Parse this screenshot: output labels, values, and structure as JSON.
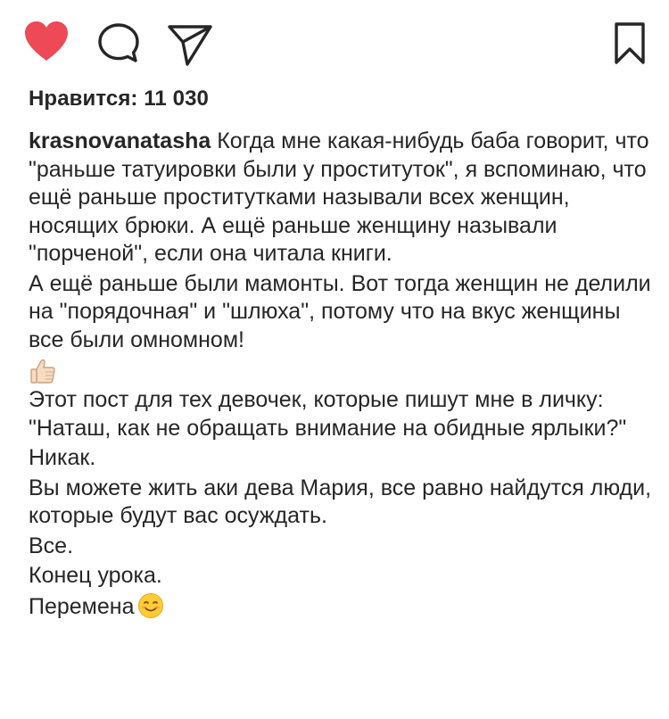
{
  "actions": {
    "like_icon": "heart-filled-icon",
    "comment_icon": "comment-bubble-icon",
    "share_icon": "paper-plane-icon",
    "save_icon": "bookmark-icon",
    "like_color": "#ed4956"
  },
  "likes": {
    "text": "Нравится: 11 030"
  },
  "caption": {
    "username": "krasnovanatasha",
    "p1": "Когда мне какая-нибудь баба говорит, что \"раньше татуировки были у проституток\", я вспоминаю, что ещё раньше проститутками называли всех женщин, носящих брюки. А ещё раньше женщину называли \"порченой\", если она читала книги.",
    "p2": "А ещё раньше были мамонты. Вот тогда женщин не делили на \"порядочная\" и \"шлюха\", потому что на вкус женщины все были омномном!",
    "thumb_icon": "thumbs-up-emoji-icon",
    "p3": "Этот пост для тех девочек, которые пишут мне в личку: \"Наташ, как не обращать внимание на обидные ярлыки?\"",
    "p4": "Никак.",
    "p5": "Вы можете жить аки дева Мария, все равно найдутся люди, которые будут вас осуждать.",
    "p6": "Все.",
    "p7": "Конец урока.",
    "p8": "Перемена",
    "smile_icon": "smiling-face-emoji-icon"
  }
}
